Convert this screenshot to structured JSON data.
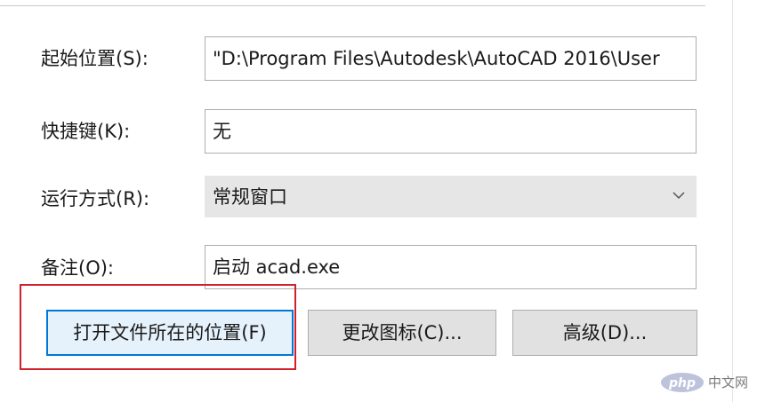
{
  "properties": {
    "start_in": {
      "label": "起始位置(S):",
      "value": "\"D:\\Program Files\\Autodesk\\AutoCAD 2016\\User"
    },
    "shortcut_key": {
      "label": "快捷键(K):",
      "value": "无"
    },
    "run": {
      "label": "运行方式(R):",
      "value": "常规窗口",
      "icon": "chevron-down-icon"
    },
    "comment": {
      "label": "备注(O):",
      "value": "启动 acad.exe"
    }
  },
  "buttons": {
    "open_file_location": "打开文件所在的位置(F)",
    "change_icon": "更改图标(C)...",
    "advanced": "高级(D)..."
  },
  "annotation": {
    "highlight_color": "#d0202a"
  },
  "watermark": {
    "logo_text": "php",
    "text": "中文网"
  }
}
